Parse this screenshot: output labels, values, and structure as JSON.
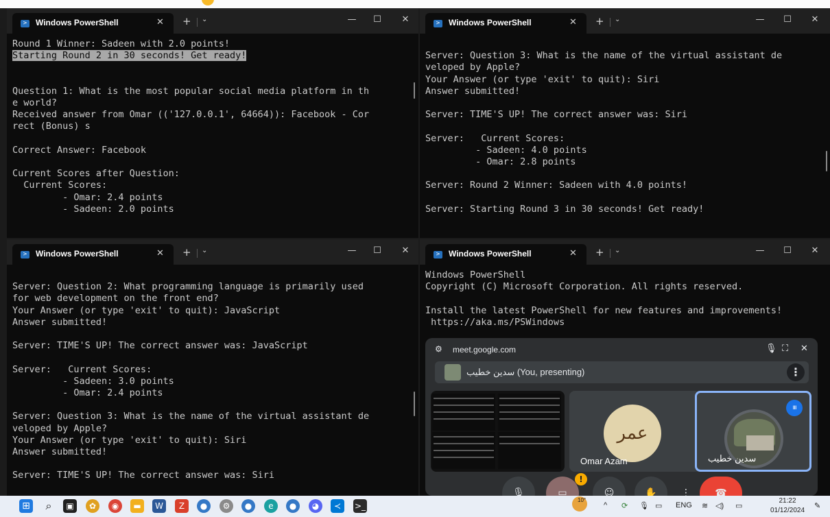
{
  "windows": [
    {
      "title": "Windows PowerShell",
      "lines": [
        "Round 1 Winner: Sadeen with 2.0 points!",
        "Starting Round 2 in 30 seconds! Get ready!",
        "",
        "",
        "Question 1: What is the most popular social media platform in th",
        "e world?",
        "Received answer from Omar (('127.0.0.1', 64664)): Facebook - Cor",
        "rect (Bonus) s",
        "",
        "Correct Answer: Facebook",
        "",
        "Current Scores after Question:",
        "  Current Scores:",
        "         - Omar: 2.4 points",
        "         - Sadeen: 2.0 points"
      ]
    },
    {
      "title": "Windows PowerShell",
      "lines": [
        "",
        "Server: Question 3: What is the name of the virtual assistant de",
        "veloped by Apple?",
        "Your Answer (or type 'exit' to quit): Siri",
        "Answer submitted!",
        "",
        "Server: TIME'S UP! The correct answer was: Siri",
        "",
        "Server:   Current Scores:",
        "         - Sadeen: 4.0 points",
        "         - Omar: 2.8 points",
        "",
        "Server: Round 2 Winner: Sadeen with 4.0 points!",
        "",
        "Server: Starting Round 3 in 30 seconds! Get ready!"
      ]
    },
    {
      "title": "Windows PowerShell",
      "lines": [
        "",
        "Server: Question 2: What programming language is primarily used",
        "for web development on the front end?",
        "Your Answer (or type 'exit' to quit): JavaScript",
        "Answer submitted!",
        "",
        "Server: TIME'S UP! The correct answer was: JavaScript",
        "",
        "Server:   Current Scores:",
        "         - Sadeen: 3.0 points",
        "         - Omar: 2.4 points",
        "",
        "Server: Question 3: What is the name of the virtual assistant de",
        "veloped by Apple?",
        "Your Answer (or type 'exit' to quit): Siri",
        "Answer submitted!",
        "",
        "Server: TIME'S UP! The correct answer was: Siri"
      ]
    },
    {
      "title": "Windows PowerShell",
      "lines": [
        "Windows PowerShell",
        "Copyright (C) Microsoft Corporation. All rights reserved.",
        "",
        "Install the latest PowerShell for new features and improvements!",
        " https://aka.ms/PSWindows"
      ]
    }
  ],
  "meet": {
    "url": "meet.google.com",
    "presenting_label": "سدين خطيب (You, presenting)",
    "participants": [
      {
        "name": "Omar Azam",
        "avatar_text": "عمر"
      },
      {
        "name": "سدين خطيب"
      }
    ],
    "warning_badge": "!"
  },
  "taskbar": {
    "weather": "10°",
    "language": "ENG",
    "time": "21:22",
    "date": "01/12/2024"
  },
  "colors": {
    "terminal_bg": "#0c0c0c",
    "terminal_text": "#cccccc",
    "meet_accent": "#8ab4f8",
    "end_call": "#ea4335"
  }
}
